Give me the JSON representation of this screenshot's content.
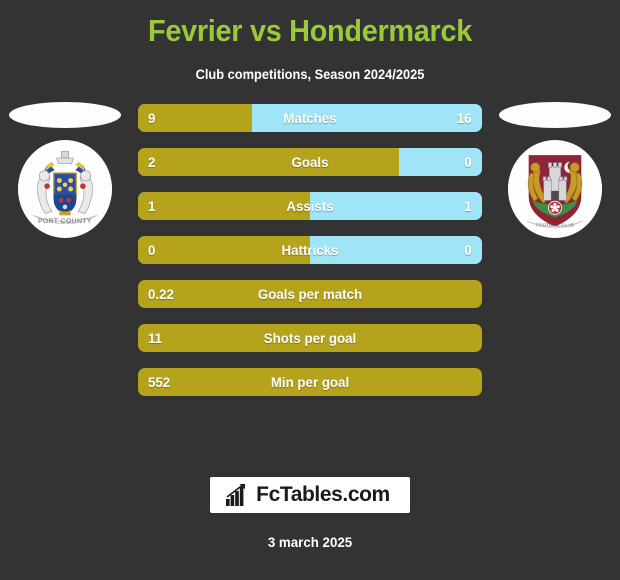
{
  "header": {
    "title": "Fevrier vs Hondermarck",
    "subtitle": "Club competitions, Season 2024/2025",
    "title_color": "#9ac93a",
    "subtitle_color": "#ffffff"
  },
  "theme": {
    "background": "#333333",
    "home_color": "#b5a31b",
    "away_color": "#a0e4f7",
    "text_color": "#ffffff"
  },
  "teams": {
    "home": {
      "badge_name": "home-team-crest",
      "crest_description": "Newport County crest: blue and gold heraldic shield with two lion supporters on white circular field"
    },
    "away": {
      "badge_name": "away-team-crest",
      "crest_description": "Maroon crest with two gold lions flanking a castle tower, green base and crescent moon"
    }
  },
  "chart_data": {
    "type": "bar",
    "title": "Fevrier vs Hondermarck",
    "subtitle": "Club competitions, Season 2024/2025",
    "categories": [
      "Matches",
      "Goals",
      "Assists",
      "Hattricks",
      "Goals per match",
      "Shots per goal",
      "Min per goal"
    ],
    "series": [
      {
        "name": "Fevrier",
        "color": "#b5a31b",
        "values": [
          "9",
          "2",
          "1",
          "0",
          "0.22",
          "11",
          "552"
        ]
      },
      {
        "name": "Hondermarck",
        "color": "#a0e4f7",
        "values": [
          "16",
          "0",
          "1",
          "0",
          null,
          null,
          null
        ]
      }
    ],
    "rows": [
      {
        "label": "Matches",
        "left": "9",
        "right": "16",
        "left_pct": 33,
        "two_sided": true
      },
      {
        "label": "Goals",
        "left": "2",
        "right": "0",
        "left_pct": 76,
        "two_sided": true
      },
      {
        "label": "Assists",
        "left": "1",
        "right": "1",
        "left_pct": 50,
        "two_sided": true
      },
      {
        "label": "Hattricks",
        "left": "0",
        "right": "0",
        "left_pct": 50,
        "two_sided": true
      },
      {
        "label": "Goals per match",
        "left": "0.22",
        "right": "",
        "left_pct": 100,
        "two_sided": false
      },
      {
        "label": "Shots per goal",
        "left": "11",
        "right": "",
        "left_pct": 100,
        "two_sided": false
      },
      {
        "label": "Min per goal",
        "left": "552",
        "right": "",
        "left_pct": 100,
        "two_sided": false
      }
    ],
    "legend": [
      "Fevrier",
      "Hondermarck"
    ],
    "grid": false
  },
  "footer": {
    "logo_text": "FcTables.com",
    "logo_icon": "bar-chart-arrow-icon",
    "date": "3 march 2025"
  }
}
